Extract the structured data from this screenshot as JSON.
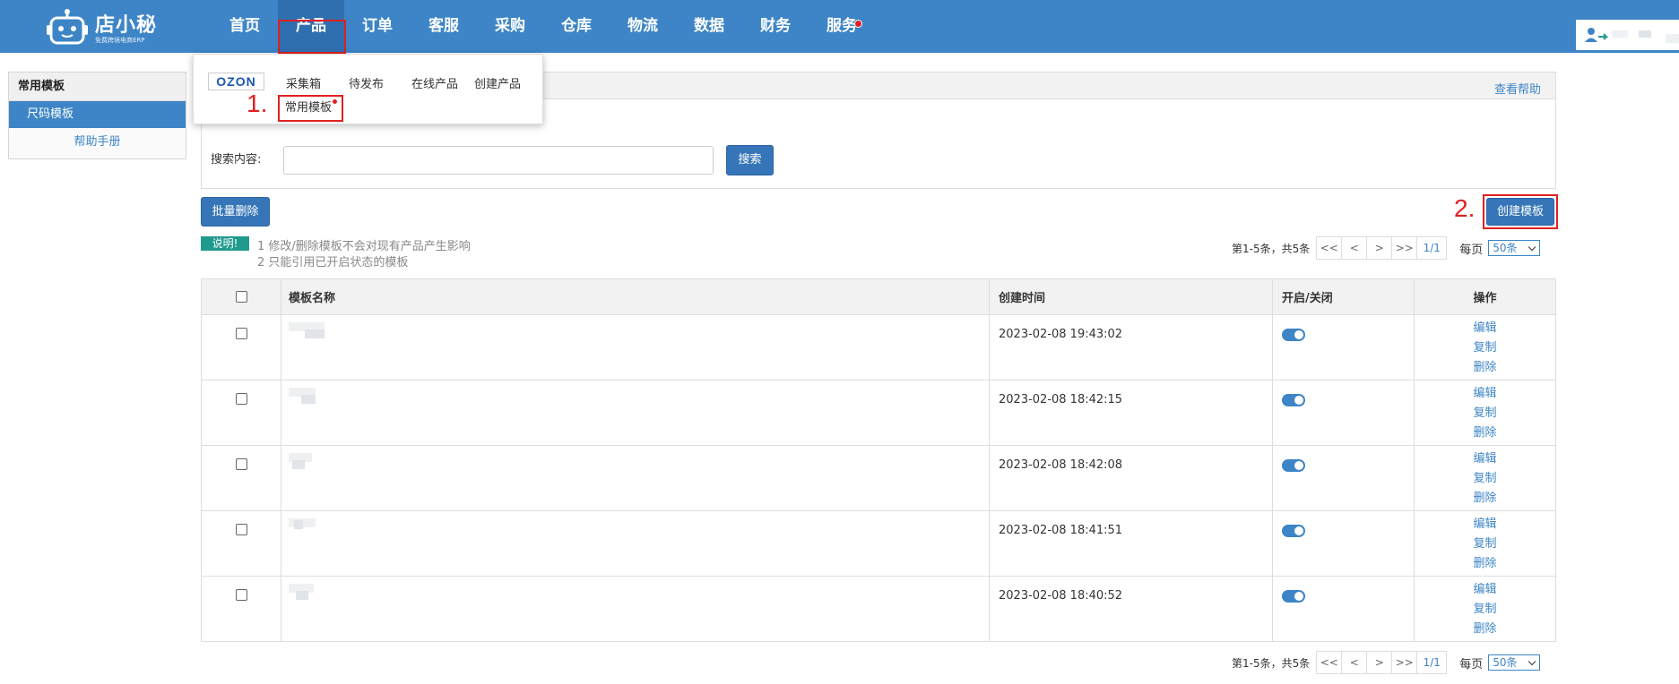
{
  "brand": {
    "name": "店小秘",
    "tagline": "免费跨境电商ERP"
  },
  "nav": [
    {
      "label": "首页"
    },
    {
      "label": "产品",
      "active": true
    },
    {
      "label": "订单"
    },
    {
      "label": "客服"
    },
    {
      "label": "采购"
    },
    {
      "label": "仓库"
    },
    {
      "label": "物流"
    },
    {
      "label": "数据"
    },
    {
      "label": "财务"
    },
    {
      "label": "服务",
      "has_dot": true
    }
  ],
  "dropdown": {
    "platform": "OZON",
    "items": [
      "采集箱",
      "待发布",
      "在线产品",
      "创建产品"
    ],
    "common_templates": "常用模板"
  },
  "markers": {
    "step1": "1.",
    "step2": "2."
  },
  "sidebar": {
    "title": "常用模板",
    "items": [
      {
        "label": "尺码模板",
        "active": true
      }
    ],
    "help": "帮助手册"
  },
  "search_panel": {
    "help_link": "查看帮助",
    "search_label": "搜索内容:",
    "search_value": "",
    "search_button": "搜索"
  },
  "actions": {
    "batch_delete": "批量删除",
    "create_template": "创建模板"
  },
  "notes": {
    "badge": "说明!",
    "lines": [
      "1 修改/删除模板不会对现有产品产生影响",
      "2 只能引用已开启状态的模板"
    ]
  },
  "pagination": {
    "summary": "第1-5条，共5条",
    "first": "<<",
    "prev": "<",
    "next": ">",
    "last": ">>",
    "current": "1/1",
    "per_page_label": "每页",
    "per_page_value": "50条"
  },
  "table": {
    "columns": {
      "name": "模板名称",
      "created": "创建时间",
      "toggle": "开启/关闭",
      "ops": "操作"
    },
    "op_labels": {
      "edit": "编辑",
      "copy": "复制",
      "delete": "删除"
    },
    "rows": [
      {
        "created": "2023-02-08 19:43:02",
        "enabled": true
      },
      {
        "created": "2023-02-08 18:42:15",
        "enabled": true
      },
      {
        "created": "2023-02-08 18:42:08",
        "enabled": true
      },
      {
        "created": "2023-02-08 18:41:51",
        "enabled": true
      },
      {
        "created": "2023-02-08 18:40:52",
        "enabled": true
      }
    ]
  },
  "colors": {
    "primary": "#3d85c6",
    "highlight": "#e02020",
    "badge": "#1f9a8c"
  }
}
